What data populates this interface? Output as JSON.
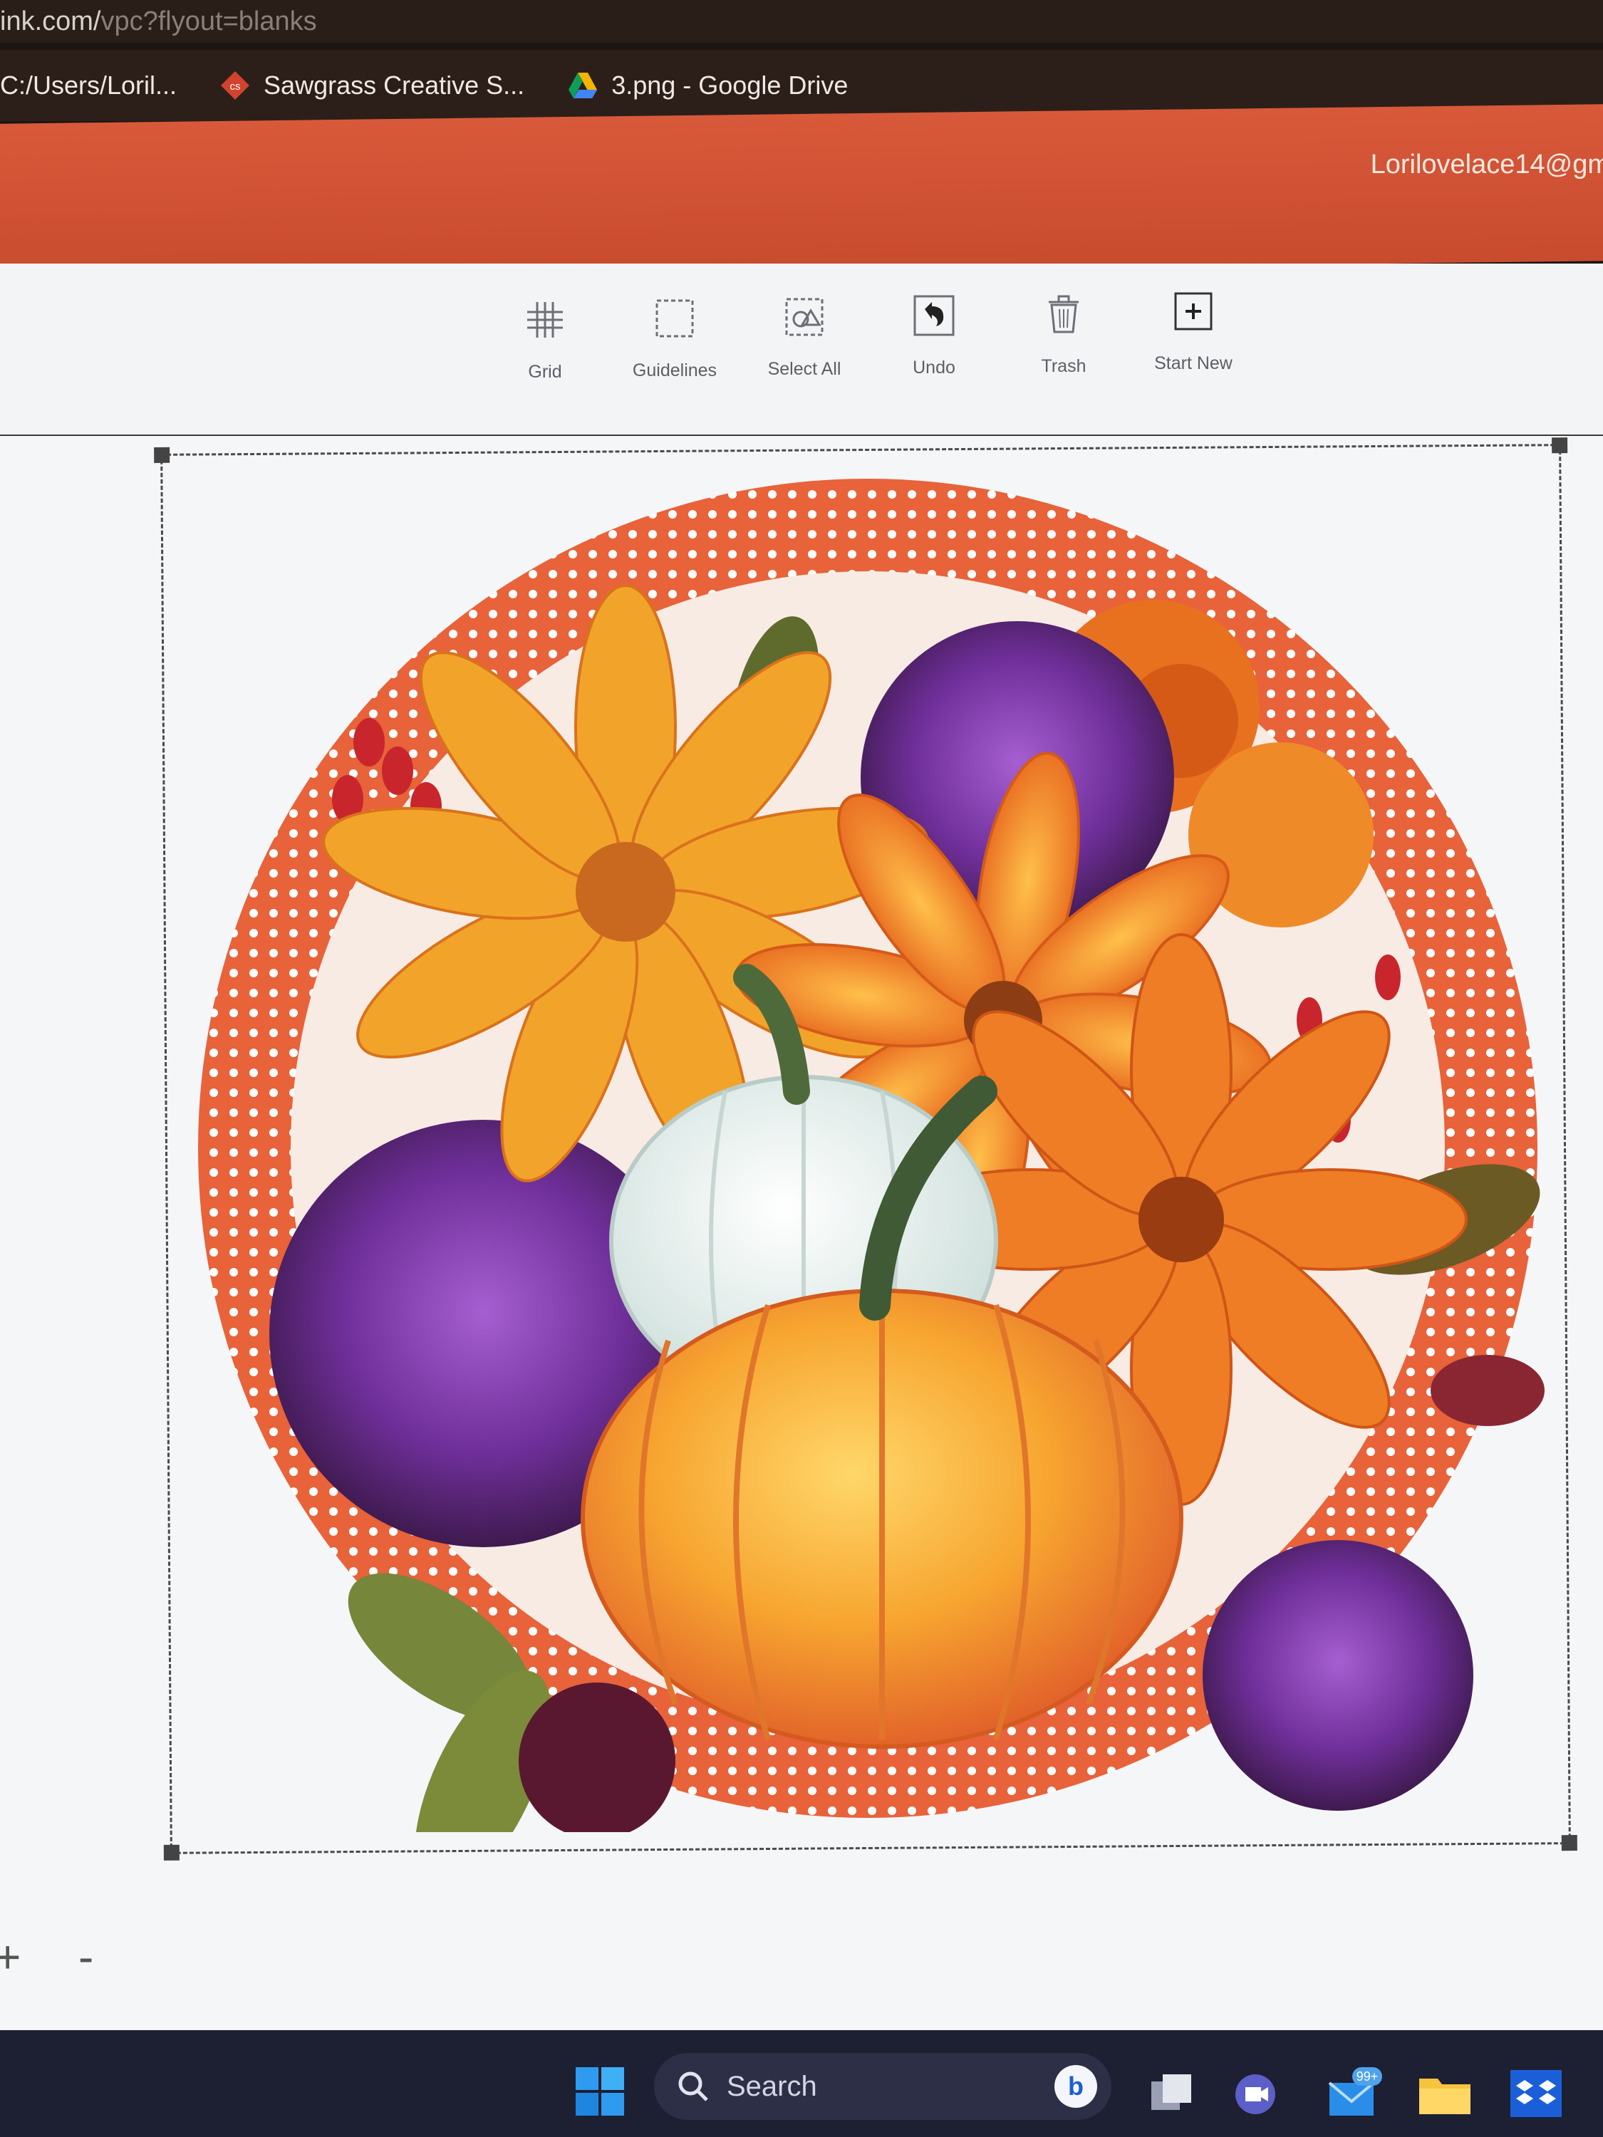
{
  "browser": {
    "url_host": "ink.com/",
    "url_path": "vpc?flyout=blanks",
    "bookmarks": [
      {
        "label": "C:/Users/Loril..."
      },
      {
        "label": "Sawgrass Creative S...",
        "icon": "sawgrass-icon",
        "badge": "cs"
      },
      {
        "label": "3.png - Google Drive",
        "icon": "google-drive-icon"
      }
    ]
  },
  "header": {
    "user_email": "Lorilovelace14@gm",
    "color": "#d4543a"
  },
  "toolbar": {
    "tools": [
      {
        "label": "Grid",
        "icon": "grid-icon"
      },
      {
        "label": "Guidelines",
        "icon": "guidelines-icon"
      },
      {
        "label": "Select All",
        "icon": "select-all-icon"
      },
      {
        "label": "Undo",
        "icon": "undo-icon"
      },
      {
        "label": "Trash",
        "icon": "trash-icon"
      },
      {
        "label": "Start New",
        "icon": "start-new-icon"
      }
    ]
  },
  "canvas": {
    "design": "round-sign-fall-pumpkin-florals",
    "ring_color": "#e8623a",
    "zoom_in": "+",
    "zoom_out": "-"
  },
  "taskbar": {
    "search_placeholder": "Search",
    "mail_badge": "99+",
    "icons": [
      "windows-start-icon",
      "search-icon",
      "bing-icon",
      "task-view-icon",
      "meet-icon",
      "mail-icon",
      "file-explorer-icon",
      "dropbox-icon"
    ]
  }
}
